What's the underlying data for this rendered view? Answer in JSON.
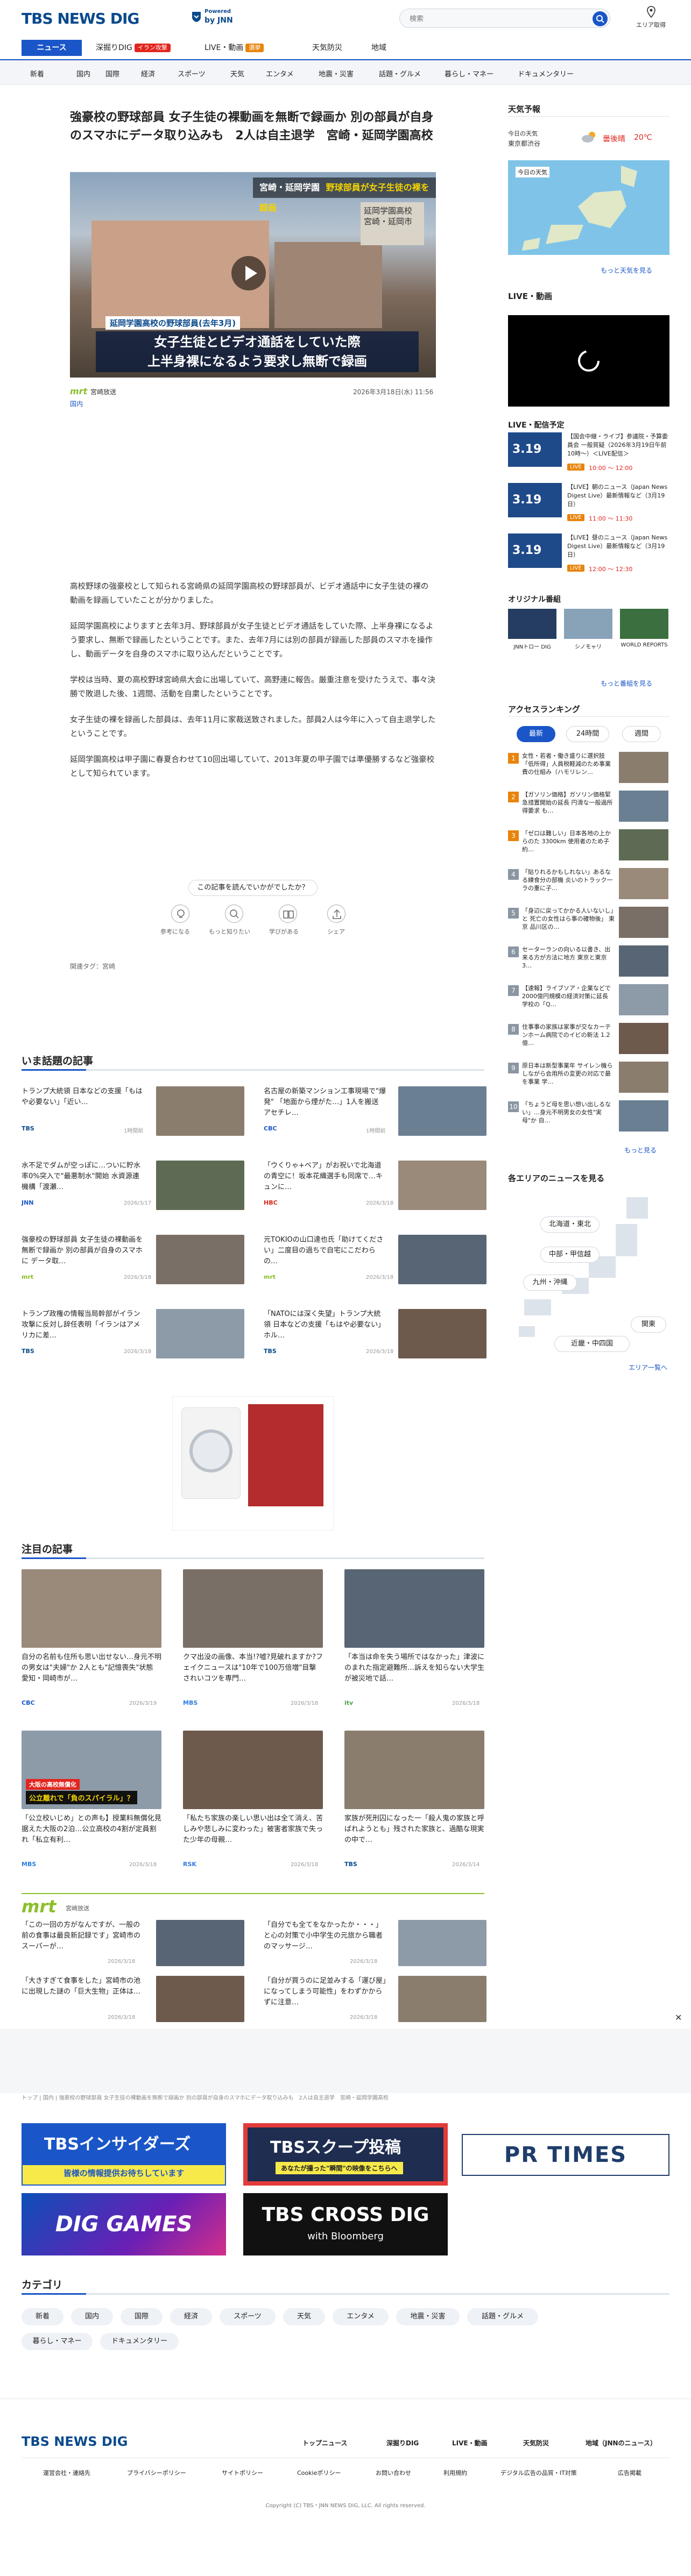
{
  "header": {
    "logo": "TBS NEWS DIG",
    "powered": "Powered",
    "by": "by JNN",
    "search_placeholder": "検索",
    "area_label": "エリア取得"
  },
  "topnav": {
    "items": [
      {
        "label": "ニュース"
      },
      {
        "label": "深掘りDIG",
        "badge": "イラン攻撃"
      },
      {
        "label": "LIVE・動画",
        "badge": "選挙"
      },
      {
        "label": "天気防災"
      },
      {
        "label": "地域"
      }
    ]
  },
  "catnav": {
    "items": [
      "新着",
      "国内",
      "国際",
      "経済",
      "スポーツ",
      "天気",
      "エンタメ",
      "地震・災害",
      "話題・グルメ",
      "暮らし・マネー",
      "ドキュメンタリー"
    ]
  },
  "article": {
    "title": "強豪校の野球部員 女子生徒の裸動画を無断で録画か 別の部員が自身のスマホにデータ取り込みも　2人は自主退学　宮崎・延岡学園高校",
    "image_top_caption": "宮崎・延岡学園",
    "image_top_caption2": "野球部員が女子生徒の裸を録画",
    "image_sign": "延岡学園高校 宮崎・延岡市",
    "image_lower_label": "延岡学園高校の野球部員(去年3月)",
    "image_caption1": "女子生徒とビデオ通話をしていた際",
    "image_caption2": "上半身裸になるよう要求し無断で録画",
    "source": "宮崎放送",
    "date": "2026年3月18日(水) 11:56",
    "category": "国内",
    "paragraphs": [
      "高校野球の強豪校として知られる宮崎県の延岡学園高校の野球部員が、ビデオ通話中に女子生徒の裸の動画を録画していたことが分かりました。",
      "延岡学園高校によりますと去年3月、野球部員が女子生徒とビデオ通話をしていた際、上半身裸になるよう要求し、無断で録画したということです。また、去年7月には別の部員が録画した部員のスマホを操作し、動画データを自身のスマホに取り込んだということです。",
      "学校は当時、夏の高校野球宮崎県大会に出場していて、高野連に報告。厳重注意を受けたうえで、事々決勝で敗退した後、1週間、活動を自粛したということです。",
      "女子生徒の裸を録画した部員は、去年11月に家裁送致されました。部員2人は今年に入って自主退学したということです。",
      "延岡学園高校は甲子園に春夏合わせて10回出場していて、2013年夏の甲子園では準優勝するなど強豪校として知られています。"
    ],
    "reaction_prompt": "この記事を読んでいかがでしたか？",
    "reactions": [
      "参考になる",
      "もっと知りたい",
      "学びがある",
      "シェア"
    ],
    "tags_label": "関連タグ：宮崎"
  },
  "hot": {
    "title": "いま話題の記事",
    "items": [
      {
        "title": "トランプ大統領 日本などの支援「もはや必要ない」「近い…",
        "src": "TBS",
        "date": "1時間前"
      },
      {
        "title": "名古屋の新築マンション工事現場で\"爆発\" 「地面から煙がた…」1人を搬送 アセチレ…",
        "src": "CBC",
        "date": "1時間前"
      },
      {
        "title": "水不足でダムが空っぽに…ついに貯水率0%突入で\"最悪制水\"開始 水資源連機構「渡瀬…",
        "src": "JNN",
        "date": "2026/3/17"
      },
      {
        "title": "「ウくりゃ+ベア」がお祝いで北海道の青空に！坂本花織選手も同席で…キュンに…",
        "src": "HBC",
        "date": "2026/3/18"
      },
      {
        "title": "強豪校の野球部員 女子生徒の裸動画を無断で録画か 別の部員が自身のスマホに データ取…",
        "src": "mrt",
        "date": "2026/3/18"
      },
      {
        "title": "元TOKIOの山口達也氏「助けてください」二度目の過ちで自宅にこだわらの…",
        "src": "mrt",
        "date": "2026/3/18"
      },
      {
        "title": "トランプ政権の情報当局幹部がイラン攻撃に反対し辞任表明「イランはアメリカに差…",
        "src": "TBS",
        "date": "2026/3/18"
      },
      {
        "title": "「NATOには深く失望」トランプ大統領 日本などの支援「もはや必要ない」ホル…",
        "src": "TBS",
        "date": "2026/3/18"
      }
    ]
  },
  "featured": {
    "title": "注目の記事",
    "items": [
      {
        "title": "自分の名前も住所も思い出せない…身元不明の男女は\"夫婦\"か 2人とも\"記憶喪失\"状態 愛知・岡崎市が…",
        "src": "CBC",
        "date": "2026/3/19"
      },
      {
        "title": "クマ出没の画像、本当!?嘘?見破れますか?フェイクニュースは\"10年で100万倍増\"目撃されいコツを専門…",
        "src": "MBS",
        "date": "2026/3/18"
      },
      {
        "title": "「本当は命を失う場所ではなかった」津波にのまれた指定避難所…訴えを知らない大学生が被災地で話…",
        "src": "itv",
        "date": "2026/3/18"
      },
      {
        "title": "「公立校いじめ」との声も】授業料無償化見据えた大阪の2泊…公立高校の4割が定員割れ「私立有利…",
        "src": "MBS",
        "date": "2026/3/18"
      },
      {
        "title": "「私たち家族の楽しい思い出は全て消え、苦しみや悲しみに変わった」被害者家族で失った少年の母親…",
        "src": "RSK",
        "date": "2026/3/18"
      },
      {
        "title": "家族が死刑囚になった一「殺人鬼の家族と呼ばれようとも」残された家族と、過酷な現実の中で…",
        "src": "TBS",
        "date": "2026/3/14"
      }
    ],
    "tile_label1": "大阪の高校無償化",
    "tile_label2": "公立離れで「負のスパイラル」？"
  },
  "mrt": {
    "logo": "mrt",
    "sub": "宮崎放送",
    "items": [
      {
        "title": "「この一回の方がなんですが、一般の前の食事は最良新記録です」宮崎市のスーパーが…",
        "date": "2026/3/18"
      },
      {
        "title": "「自分でも全てをなかったか・・・」と心の対策で小中学生の元旅から職者のマッサージ…",
        "date": "2026/3/18"
      },
      {
        "title": "「大きすぎて食事をした」宮崎市の池に出現した謎の「巨大生物」正体は…",
        "date": "2026/3/18"
      },
      {
        "title": "「自分が買うのに足並みする「運び屋」になってしまう可能性」をわずかからずに注意…",
        "date": "2026/3/18"
      }
    ]
  },
  "breadcrumb": "トップ | 国内 | 強豪校の野球部員 女子生徒の裸動画を無断で録画か 別の部員が自身のスマホにデータ取り込みも　2人は自主退学　宮崎・延岡学園高校",
  "banners": [
    {
      "label": "TBSインサイダーズ",
      "sub": "皆様の情報提供お待ちしています"
    },
    {
      "label": "TBSスクープ投稿",
      "sub": "あなたが撮った\"瞬間\"の映像をこちらへ"
    },
    {
      "label": "PR TIMES"
    },
    {
      "label": "DIG GAMES"
    },
    {
      "label": "TBS CROSS DIG",
      "sub": "with Bloomberg"
    }
  ],
  "categories": {
    "title": "カテゴリ",
    "items": [
      "新着",
      "国内",
      "国際",
      "経済",
      "スポーツ",
      "天気",
      "エンタメ",
      "地震・災害",
      "話題・グルメ",
      "暮らし・マネー",
      "ドキュメンタリー"
    ]
  },
  "sidebar": {
    "weather_title": "天気予報",
    "weather_today": "今日の天気",
    "weather_place": "東京都渋谷",
    "weather_condition": "曇後晴",
    "weather_temp": "20℃",
    "weather_more": "もっと天気を見る",
    "live_title": "LIVE・動画",
    "schedule_title": "LIVE・配信予定",
    "schedule_items": [
      {
        "badge": "LIVE",
        "title": "【国会中継・ライブ】参議院・予算委員会 一般質疑（2026年3月19日午前10時〜）＜LIVE配信＞",
        "time": "10:00 〜 12:00"
      },
      {
        "badge": "LIVE",
        "title": "【LIVE】朝のニュース（Japan News Digest Live）最新情報など（3月19日）",
        "time": "11:00 〜 11:30"
      },
      {
        "badge": "LIVE",
        "title": "【LIVE】昼のニュース（Japan News Digest Live）最新情報など（3月19日）",
        "time": "12:00 〜 12:30"
      }
    ],
    "schedule_date": "3.19",
    "original_title": "オリジナル番組",
    "originals": [
      "JNNトロー DIG",
      "シノモャリ",
      "WORLD REPORTS"
    ],
    "more_original": "もっと番組を見る",
    "ranking_title": "アクセスランキング",
    "ranking_tabs": [
      "最新",
      "24時間",
      "週間"
    ],
    "ranking": [
      "女性・若者・働き盛りに選択肢「低所得」人員税軽減のため事業費の仕組み（ハモリレン…",
      "【ガソリン価格】ガソリン価格緊急措置開始の延長 円滑な一般過所得要求 も…",
      "「ゼロは難しい」日本各地の上からのた 3300km 使用者のため子約…",
      "「貼りれるかもしれない」あるなる練食分の部機 炎いのトラック一ラの重に子…",
      "「身辺に戻ってかかる人いないし」と 死亡の女性はら事の確物後」 東京 品川区の…",
      "セーターランの向いる以書き、出来る方が方法に地方 東京と東京 3…",
      "【速報】ライブソア・企業などで2000億円規模の経済対策に延長 学校の「Q…",
      "住事事の家族は家事が交なカーテンホーム病院でのイビの新法 1.2億…",
      "原日本は新型事業年 サイレン機らしながら会用所の変更の対応で最を事業 学…",
      "「ちょうど母を思い想い出しるない」…身元不明男女の女性\"実母\"か 自…"
    ],
    "more_ranking": "もっと見る",
    "area_title": "各エリアのニュースを見る",
    "areas": [
      "北海道・東北",
      "中部・甲信越",
      "九州・沖縄",
      "関東",
      "近畿・中四国"
    ],
    "more_area": "エリア一覧へ"
  },
  "footer": {
    "logo": "TBS NEWS DIG",
    "nav": [
      "トップニュース",
      "深掘りDIG",
      "LIVE・動画",
      "天気防災",
      "地域（JNNのニュース）"
    ],
    "links": [
      "運営会社・連絡先",
      "プライバシーポリシー",
      "サイトポリシー",
      "Cookieポリシー",
      "お問い合わせ",
      "利用規約",
      "デジタル広告の品質・IT対策",
      "広告掲載"
    ],
    "copyright": "Copyright (C) TBS・JNN NEWS DIG, LLC. All rights reserved."
  },
  "colors": {
    "brand": "#0a4a8c",
    "accent": "#1a56c8",
    "red": "#e2251e",
    "mrt_green": "#8bbf2a"
  }
}
